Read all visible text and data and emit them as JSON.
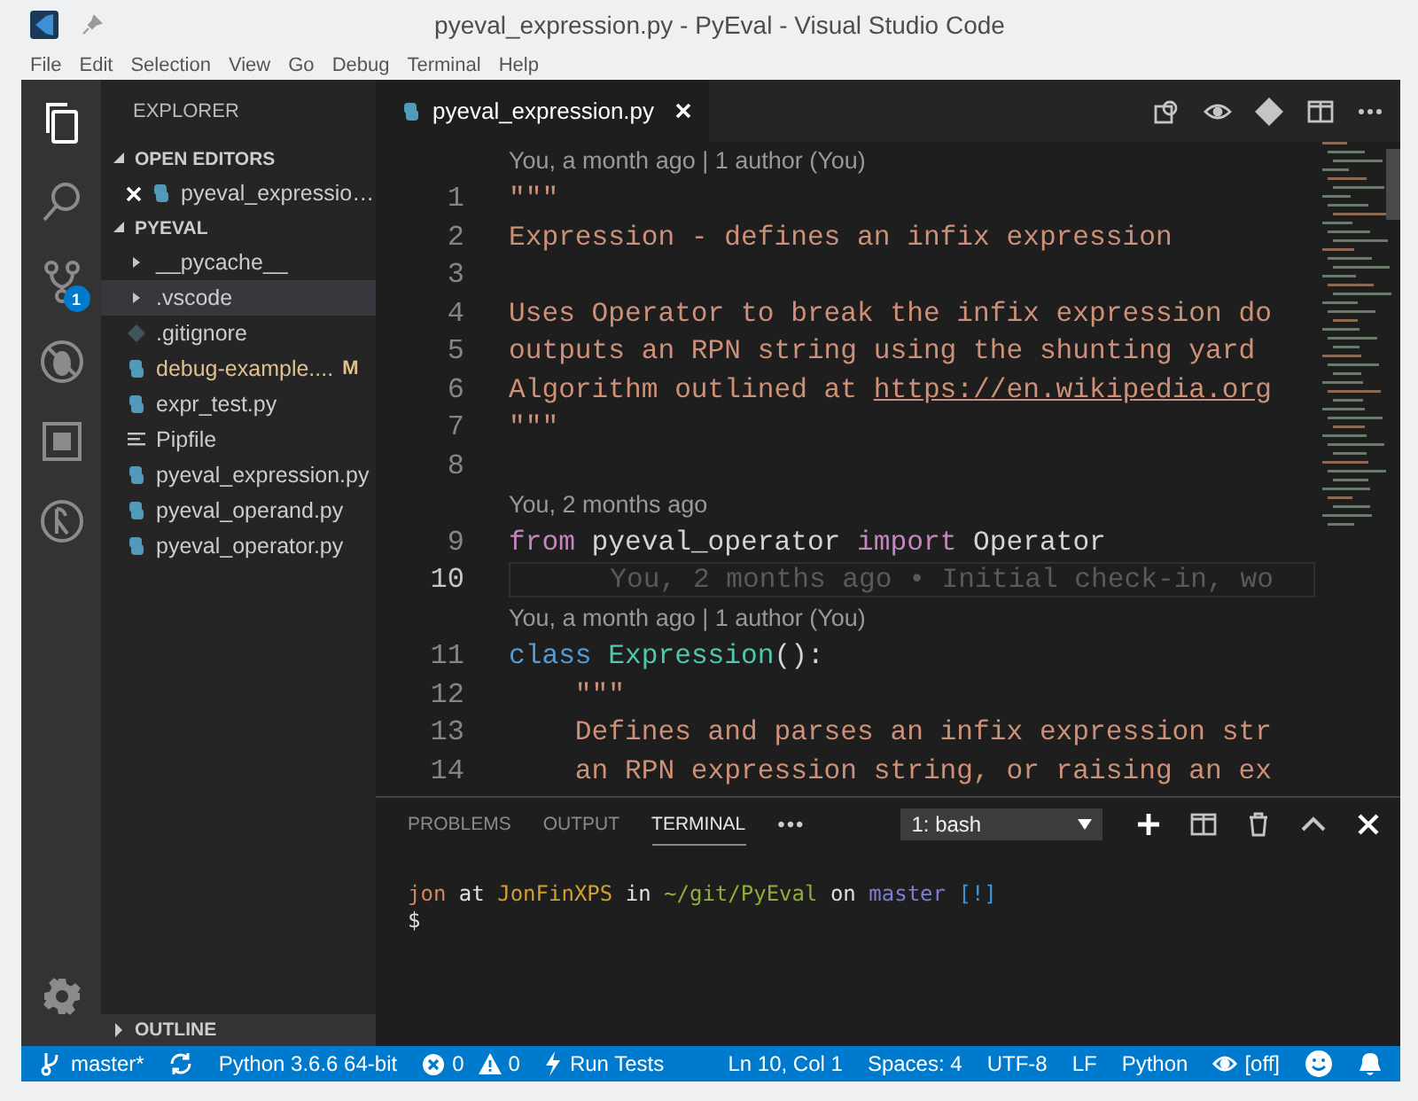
{
  "window": {
    "title": "pyeval_expression.py - PyEval - Visual Studio Code"
  },
  "menu": [
    "File",
    "Edit",
    "Selection",
    "View",
    "Go",
    "Debug",
    "Terminal",
    "Help"
  ],
  "activity_bar": {
    "items": [
      {
        "kind": "files",
        "selected": true
      },
      {
        "kind": "search",
        "selected": false
      },
      {
        "kind": "source-control",
        "selected": false,
        "badge": "1"
      },
      {
        "kind": "debug",
        "selected": false
      },
      {
        "kind": "extensions",
        "selected": false
      },
      {
        "kind": "history",
        "selected": false
      }
    ],
    "bottom": [
      {
        "kind": "settings"
      }
    ]
  },
  "sidebar": {
    "title": "EXPLORER",
    "sections": [
      {
        "title": "OPEN EDITORS",
        "expanded": true,
        "items": [
          {
            "kind": "python",
            "name": "pyeval_expressio…",
            "selected": false,
            "modified": false,
            "closable": true
          }
        ]
      },
      {
        "title": "PYEVAL",
        "expanded": true,
        "items": [
          {
            "kind": "folder",
            "name": "__pycache__",
            "selected": false,
            "modified": false
          },
          {
            "kind": "folder",
            "name": ".vscode",
            "selected": true,
            "modified": false
          },
          {
            "kind": "git",
            "name": ".gitignore",
            "selected": false,
            "modified": false
          },
          {
            "kind": "python",
            "name": "debug-example....",
            "selected": false,
            "modified": true,
            "status": "M"
          },
          {
            "kind": "python",
            "name": "expr_test.py",
            "selected": false,
            "modified": false
          },
          {
            "kind": "text",
            "name": "Pipfile",
            "selected": false,
            "modified": false
          },
          {
            "kind": "python",
            "name": "pyeval_expression.py",
            "selected": false,
            "modified": false
          },
          {
            "kind": "python",
            "name": "pyeval_operand.py",
            "selected": false,
            "modified": false
          },
          {
            "kind": "python",
            "name": "pyeval_operator.py",
            "selected": false,
            "modified": false
          }
        ]
      },
      {
        "title": "OUTLINE",
        "expanded": false
      }
    ]
  },
  "editor": {
    "tabs": [
      {
        "kind": "python",
        "title": "pyeval_expression.py",
        "selected": true,
        "closable": true
      }
    ],
    "lines": [
      {
        "kind": "lens",
        "text": "You, a month ago | 1 author (You)"
      },
      {
        "kind": "code",
        "number": "1",
        "current": false,
        "tokens": [
          {
            "kind": "string",
            "text": "\"\"\""
          }
        ]
      },
      {
        "kind": "code",
        "number": "2",
        "current": false,
        "tokens": [
          {
            "kind": "string",
            "text": "Expression - defines an infix expression"
          }
        ]
      },
      {
        "kind": "code",
        "number": "3",
        "current": false
      },
      {
        "kind": "code",
        "number": "4",
        "current": false,
        "tokens": [
          {
            "kind": "string",
            "text": "Uses Operator to break the infix expression do"
          }
        ]
      },
      {
        "kind": "code",
        "number": "5",
        "current": false,
        "tokens": [
          {
            "kind": "string",
            "text": "outputs an RPN string using the shunting yard"
          }
        ]
      },
      {
        "kind": "code",
        "number": "6",
        "current": false,
        "tokens": [
          {
            "kind": "string",
            "text": "Algorithm outlined at "
          },
          {
            "kind": "link",
            "text": "https://en.wikipedia.org"
          }
        ]
      },
      {
        "kind": "code",
        "number": "7",
        "current": false,
        "tokens": [
          {
            "kind": "string",
            "text": "\"\"\""
          }
        ]
      },
      {
        "kind": "code",
        "number": "8",
        "current": false
      },
      {
        "kind": "lens",
        "text": "You, 2 months ago"
      },
      {
        "kind": "code",
        "number": "9",
        "current": false,
        "tokens": [
          {
            "kind": "keyword",
            "text": "from"
          },
          {
            "kind": "plain",
            "text": " pyeval_operator "
          },
          {
            "kind": "keyword",
            "text": "import"
          },
          {
            "kind": "plain",
            "text": " Operator"
          }
        ]
      },
      {
        "kind": "code",
        "number": "10",
        "current": true,
        "blame": "You, 2 months ago • Initial check-in, wo"
      },
      {
        "kind": "lens",
        "text": "You, a month ago | 1 author (You)"
      },
      {
        "kind": "code",
        "number": "11",
        "current": false,
        "tokens": [
          {
            "kind": "storage",
            "text": "class "
          },
          {
            "kind": "type",
            "text": "Expression"
          },
          {
            "kind": "plain",
            "text": "():"
          }
        ]
      },
      {
        "kind": "code",
        "number": "12",
        "current": false,
        "tokens": [
          {
            "kind": "string",
            "text": "    \"\"\""
          }
        ]
      },
      {
        "kind": "code",
        "number": "13",
        "current": false,
        "tokens": [
          {
            "kind": "string",
            "text": "    Defines and parses an infix expression str"
          }
        ]
      },
      {
        "kind": "code",
        "number": "14",
        "current": false,
        "tokens": [
          {
            "kind": "string",
            "text": "    an RPN expression string, or raising an ex"
          }
        ]
      }
    ]
  },
  "panel": {
    "tabs": [
      {
        "label": "PROBLEMS",
        "selected": false
      },
      {
        "label": "OUTPUT",
        "selected": false
      },
      {
        "label": "TERMINAL",
        "selected": true
      }
    ],
    "more": "•••",
    "terminal_select": "1: bash",
    "terminal_lines": [
      {
        "segments": [
          {
            "text": "jon",
            "color": "#d7875f"
          },
          {
            "text": " at ",
            "color": "#e0e0e0"
          },
          {
            "text": "JonFinXPS",
            "color": "#d0a030"
          },
          {
            "text": " in ",
            "color": "#e0e0e0"
          },
          {
            "text": "~/git/PyEval",
            "color": "#8fae3a"
          },
          {
            "text": " on ",
            "color": "#e0e0e0"
          },
          {
            "text": "master",
            "color": "#7c7fd0"
          },
          {
            "text": " [!]",
            "color": "#3a96dd"
          }
        ]
      },
      {
        "segments": [
          {
            "text": "$",
            "color": "#e0e0e0"
          }
        ]
      }
    ]
  },
  "status_bar": {
    "left": [
      {
        "kind": "branch",
        "text": "master*"
      },
      {
        "kind": "sync"
      },
      {
        "kind": "text",
        "text": "Python 3.6.6 64-bit"
      },
      {
        "kind": "problems",
        "errors": "0",
        "warnings": "0"
      },
      {
        "kind": "bolt",
        "text": "Run Tests"
      }
    ],
    "right": [
      {
        "kind": "text",
        "text": "Ln 10, Col 1"
      },
      {
        "kind": "text",
        "text": "Spaces: 4"
      },
      {
        "kind": "text",
        "text": "UTF-8"
      },
      {
        "kind": "text",
        "text": "LF"
      },
      {
        "kind": "text",
        "text": "Python"
      },
      {
        "kind": "eye",
        "text": "[off]"
      },
      {
        "kind": "smiley"
      },
      {
        "kind": "bell"
      }
    ]
  }
}
